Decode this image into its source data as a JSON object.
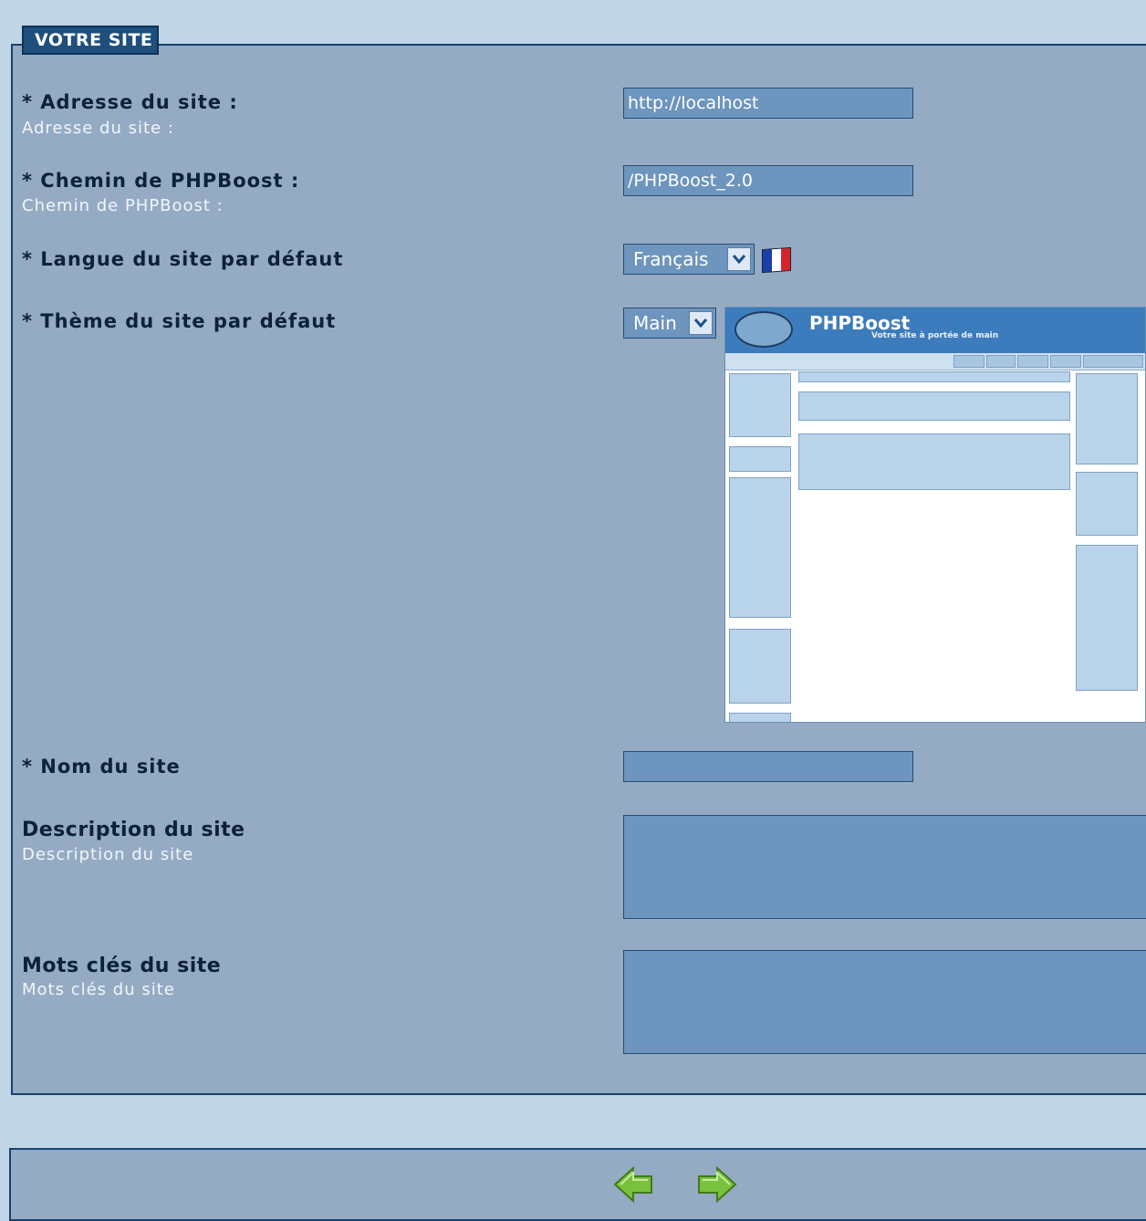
{
  "section": {
    "legend": "VOTRE SITE"
  },
  "fields": {
    "site_address": {
      "label": "* Adresse du site :",
      "help": "Adresse du site :",
      "value": "http://localhost"
    },
    "phpboost_path": {
      "label": "* Chemin de PHPBoost :",
      "help": "Chemin de PHPBoost :",
      "value": "/PHPBoost_2.0"
    },
    "default_language": {
      "label": "* Langue du site par défaut",
      "selected": "Français",
      "flag_icon": "french-flag-icon"
    },
    "default_theme": {
      "label": "* Thème du site par défaut",
      "selected": "Main"
    },
    "site_name": {
      "label": "* Nom du site",
      "value": ""
    },
    "site_description": {
      "label": "Description du site",
      "help": "Description du site",
      "value": ""
    },
    "site_keywords": {
      "label": "Mots clés du site",
      "help": "Mots clés du site",
      "value": ""
    }
  },
  "theme_preview": {
    "title": "PHPBoost",
    "slogan": "Votre site à portée de main"
  },
  "navigation": {
    "previous_icon": "arrow-left-icon",
    "next_icon": "arrow-right-icon"
  },
  "colors": {
    "page_background": "#c0d5e6",
    "panel": "#95abc4",
    "field": "#6d95bd",
    "border": "#17426c",
    "arrow_green": "#79c23d"
  }
}
